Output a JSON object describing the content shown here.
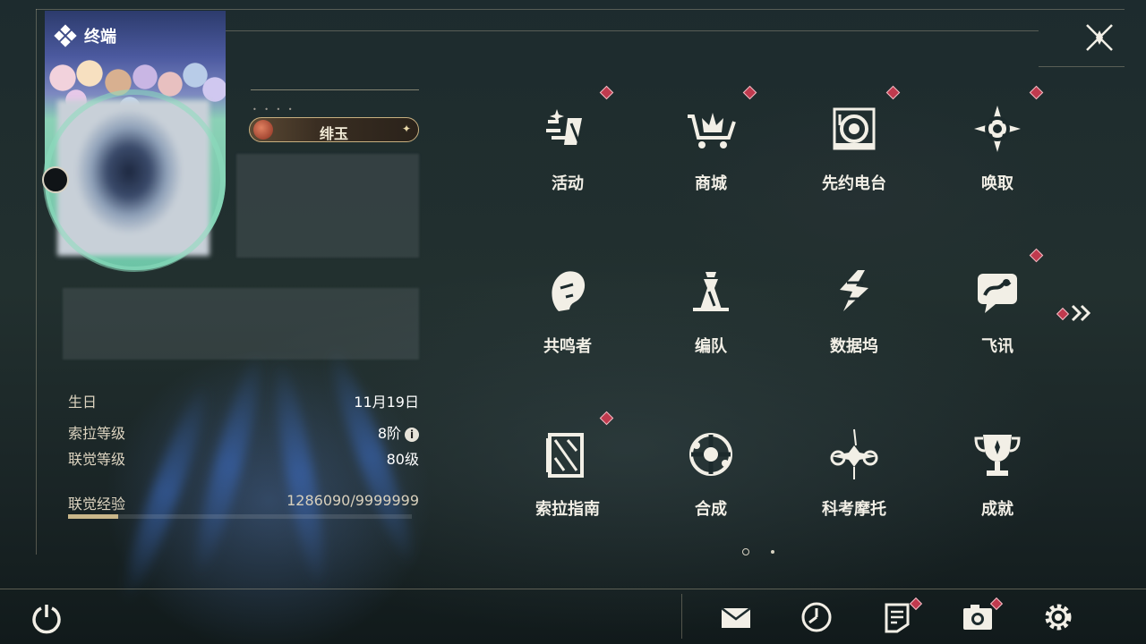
{
  "header": {
    "title": "终端",
    "close_icon": "close-x-icon"
  },
  "profile": {
    "name": "绯玉",
    "stats": [
      {
        "label": "生日",
        "value": "11月19日"
      },
      {
        "label": "索拉等级",
        "value": "8阶"
      },
      {
        "label": "联觉等级",
        "value": "80级"
      },
      {
        "label": "联觉经验",
        "value": "1286090/9999999"
      }
    ],
    "exp_progress": 0.1286
  },
  "menu": {
    "items": [
      {
        "label": "活动",
        "icon": "event-icon",
        "badge": true
      },
      {
        "label": "商城",
        "icon": "shop-icon",
        "badge": true
      },
      {
        "label": "先约电台",
        "icon": "radio-icon",
        "badge": true
      },
      {
        "label": "唤取",
        "icon": "convene-icon",
        "badge": true
      },
      {
        "label": "共鸣者",
        "icon": "resonator-icon",
        "badge": false
      },
      {
        "label": "编队",
        "icon": "team-icon",
        "badge": false
      },
      {
        "label": "数据坞",
        "icon": "data-bank-icon",
        "badge": false
      },
      {
        "label": "飞讯",
        "icon": "message-icon",
        "badge": true
      },
      {
        "label": "索拉指南",
        "icon": "guide-icon",
        "badge": true
      },
      {
        "label": "合成",
        "icon": "synthesis-icon",
        "badge": false
      },
      {
        "label": "科考摩托",
        "icon": "motorcycle-icon",
        "badge": false
      },
      {
        "label": "成就",
        "icon": "trophy-icon",
        "badge": false
      }
    ],
    "page_count": 2,
    "current_page": 1,
    "next_badge": true
  },
  "bottom_bar": {
    "items": [
      {
        "icon": "power-icon"
      },
      {
        "icon": "mail-icon",
        "badge": false
      },
      {
        "icon": "clock-icon",
        "badge": false
      },
      {
        "icon": "notice-icon",
        "badge": true
      },
      {
        "icon": "camera-icon",
        "badge": true
      },
      {
        "icon": "settings-gear-icon",
        "badge": false
      }
    ]
  },
  "colors": {
    "accent_gold": "#c9b78a",
    "badge_red": "#c03a4e",
    "text_main": "#f2efe6"
  }
}
